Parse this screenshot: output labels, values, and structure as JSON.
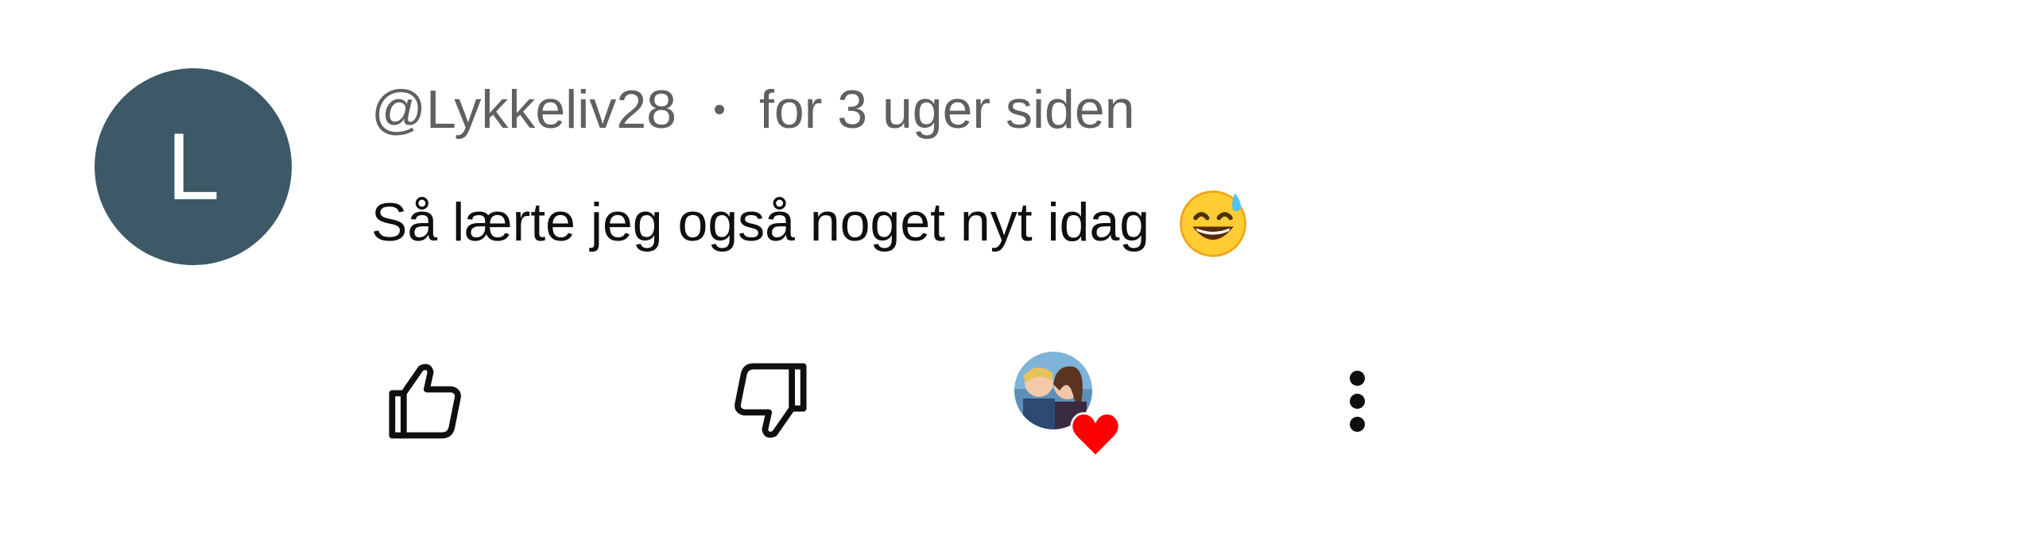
{
  "comment": {
    "avatar_letter": "L",
    "avatar_color": "#3d5866",
    "author": "@Lykkeliv28",
    "timestamp": "for 3 uger siden",
    "text": "Så lærte jeg også noget nyt idag",
    "emoji": "grinning-face-with-sweat",
    "actions": {
      "like_icon": "thumb-up-icon",
      "dislike_icon": "thumb-down-icon",
      "hearted_by_creator": true,
      "heart_color": "#ff0000",
      "more_icon": "more-vertical-icon"
    }
  }
}
